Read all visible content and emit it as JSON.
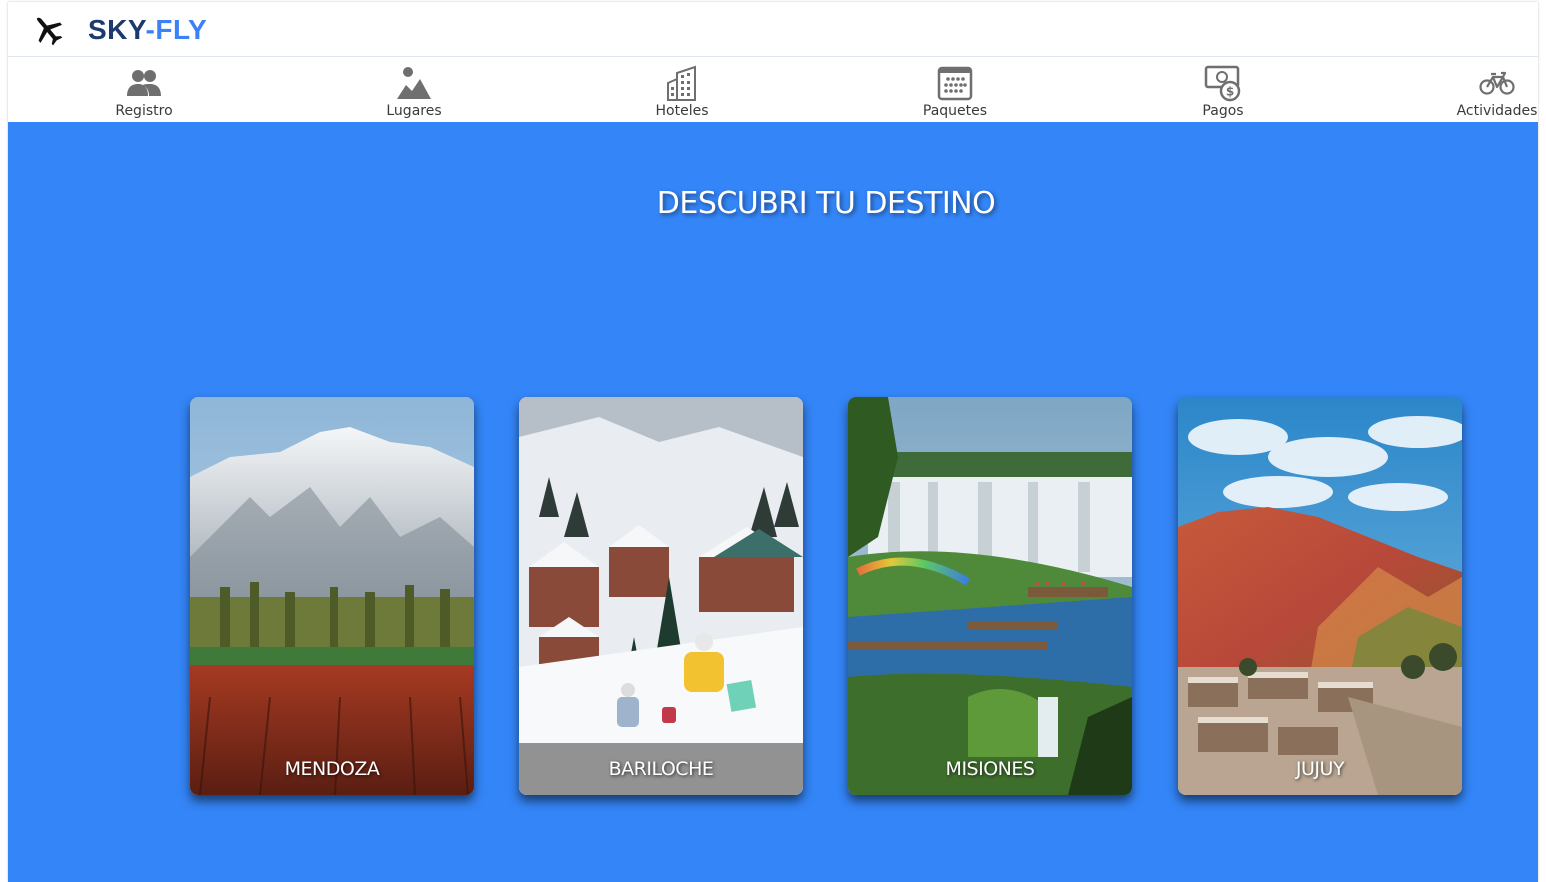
{
  "brand": {
    "part1": "SKY",
    "dash": "-",
    "part2": "FLY"
  },
  "nav": {
    "items": [
      {
        "label": "Registro",
        "icon": "users-icon"
      },
      {
        "label": "Lugares",
        "icon": "landscape-icon"
      },
      {
        "label": "Hoteles",
        "icon": "building-icon"
      },
      {
        "label": "Paquetes",
        "icon": "calendar-icon"
      },
      {
        "label": "Pagos",
        "icon": "money-icon"
      },
      {
        "label": "Actividades",
        "icon": "bicycle-icon"
      }
    ]
  },
  "hero": {
    "title": "DESCUBRI TU DESTINO",
    "cards": [
      {
        "caption": "MENDOZA"
      },
      {
        "caption": "BARILOCHE"
      },
      {
        "caption": "MISIONES"
      },
      {
        "caption": "JUJUY"
      }
    ]
  },
  "colors": {
    "hero_bg": "#3485f7",
    "brand_dark": "#1c3a6e",
    "brand_accent": "#3b82f6",
    "icon_gray": "#6f6f6f"
  }
}
